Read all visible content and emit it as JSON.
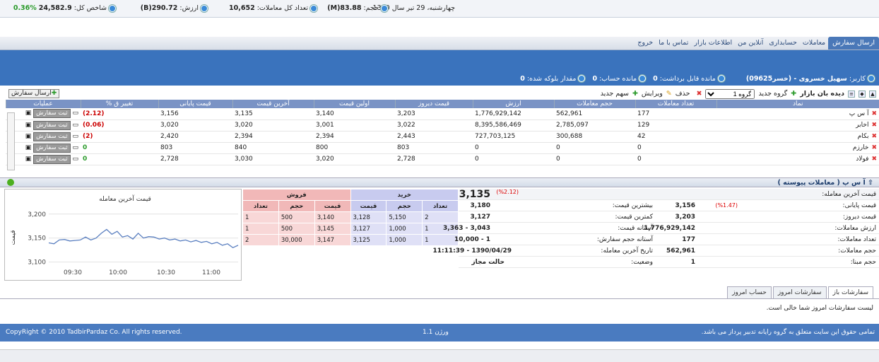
{
  "info": {
    "date": "چهارشنبه، 29 تیر سال 1390",
    "volume_label": "حجم:",
    "volume": "83.88(M)",
    "trades_label": "تعداد کل معاملات:",
    "trades": "10,652",
    "value_label": "ارزش:",
    "value": "290.72(B)",
    "index_label": "شاخص کل:",
    "index": "24,582.9",
    "index_change": "0.36%"
  },
  "nav": [
    "ارسال سفارش",
    "معاملات",
    "حسابداری",
    "آنلاین من",
    "اطلاعات بازار",
    "تماس با ما",
    "خروج"
  ],
  "user": {
    "user_label": "کاربر:",
    "user_name": "سهیل خسروی - (خسر09625)",
    "withdraw_label": "مانده قابل برداشت:",
    "withdraw": "0",
    "account_label": "مانده حساب:",
    "account": "0",
    "blocked_label": "مقدار بلوکه شده:",
    "blocked": "0"
  },
  "toolbar": {
    "market_watch": "دیده بان بازار",
    "new_group": "گروه جدید",
    "group_value": "گروه 1",
    "delete": "حذف",
    "edit": "ویرایش",
    "new_symbol": "سهم جدید",
    "send_order": "ارسال سفارش"
  },
  "table": {
    "headers": [
      "نماد",
      "تعداد معاملات",
      "حجم معاملات",
      "ارزش",
      "قیمت دیروز",
      "اولین قیمت",
      "آخرین قیمت",
      "قیمت پایانی",
      "تغییر ق %",
      "عملیات"
    ],
    "rows": [
      [
        "آ س پ",
        "177",
        "562,961",
        "1,776,929,142",
        "3,203",
        "3,140",
        "3,135",
        "3,156",
        "(2.12)"
      ],
      [
        "اخابر",
        "129",
        "2,785,097",
        "8,395,586,469",
        "3,022",
        "3,001",
        "3,020",
        "3,020",
        "(0.06)"
      ],
      [
        "بکام",
        "42",
        "300,688",
        "727,703,125",
        "2,443",
        "2,394",
        "2,394",
        "2,420",
        "(2)"
      ],
      [
        "خارزم",
        "0",
        "0",
        "0",
        "803",
        "800",
        "840",
        "803",
        "0"
      ],
      [
        "فولاد",
        "0",
        "0",
        "0",
        "2,728",
        "3,020",
        "3,030",
        "2,728",
        "0"
      ]
    ],
    "order_label": "ثبت سفارش"
  },
  "detail": {
    "title": "آ س پ ( معاملات پیوسته )",
    "last_price": "3,135",
    "last_change": "(%2.12)",
    "labels": [
      "قیمت آخرین معامله:",
      "قیمت پایانی:",
      "قیمت دیروز:",
      "ارزش معاملات:",
      "تعداد معاملات:",
      "حجم معاملات:",
      "حجم مبنا:"
    ],
    "values": [
      "",
      "3,156",
      "3,203",
      "1,776,929,142",
      "177",
      "562,961",
      "1"
    ],
    "final_change": "(%1.47)",
    "labels2": [
      "بیشترین قیمت:",
      "کمترین قیمت:",
      "آستانه قیمت:",
      "آستانه حجم سفارش:",
      "تاریخ آخرین معامله:",
      "وضعیت:"
    ],
    "values2": [
      "3,180",
      "3,127",
      "3,043 - 3,363",
      "1 - 10,000",
      "1390/04/29 - 11:11:39",
      "حالت مجاز"
    ]
  },
  "orderbook": {
    "buy": "خرید",
    "sell": "فروش",
    "count": "تعداد",
    "volume": "حجم",
    "price": "قیمت",
    "rows": [
      [
        "2",
        "5,150",
        "3,128",
        "3,140",
        "500",
        "1"
      ],
      [
        "1",
        "1,000",
        "3,127",
        "3,145",
        "500",
        "1"
      ],
      [
        "1",
        "1,000",
        "3,125",
        "3,147",
        "30,000",
        "2"
      ]
    ]
  },
  "chart_data": {
    "type": "line",
    "title": "قیمت آخرین معامله",
    "ylabel": "قیمت",
    "x_ticks": [
      "09:30",
      "10:00",
      "10:30",
      "11:00"
    ],
    "y_ticks": [
      "3,100",
      "3,150",
      "3,200"
    ],
    "ylim": [
      3095,
      3210
    ],
    "values": [
      3140,
      3138,
      3146,
      3147,
      3144,
      3145,
      3146,
      3152,
      3146,
      3150,
      3160,
      3168,
      3158,
      3164,
      3152,
      3155,
      3148,
      3160,
      3150,
      3153,
      3152,
      3148,
      3150,
      3146,
      3148,
      3144,
      3146,
      3142,
      3145,
      3141,
      3143,
      3138,
      3141,
      3135,
      3138,
      3130,
      3135
    ],
    "color": "#5a7fc0"
  },
  "bottom_tabs": [
    "سفارشات باز",
    "سفارشات امروز",
    "حساب امروز"
  ],
  "empty_message": "لیست سفارشات امروز شما خالی است.",
  "footer": {
    "rights": "تمامی حقوق این سایت متعلق به گروه رایانه تدبیر پرداز می باشد.",
    "version": "ورژن 1.1",
    "copyright": "CopyRight © 2010 TadbirPardaz Co. All rights reserved."
  }
}
